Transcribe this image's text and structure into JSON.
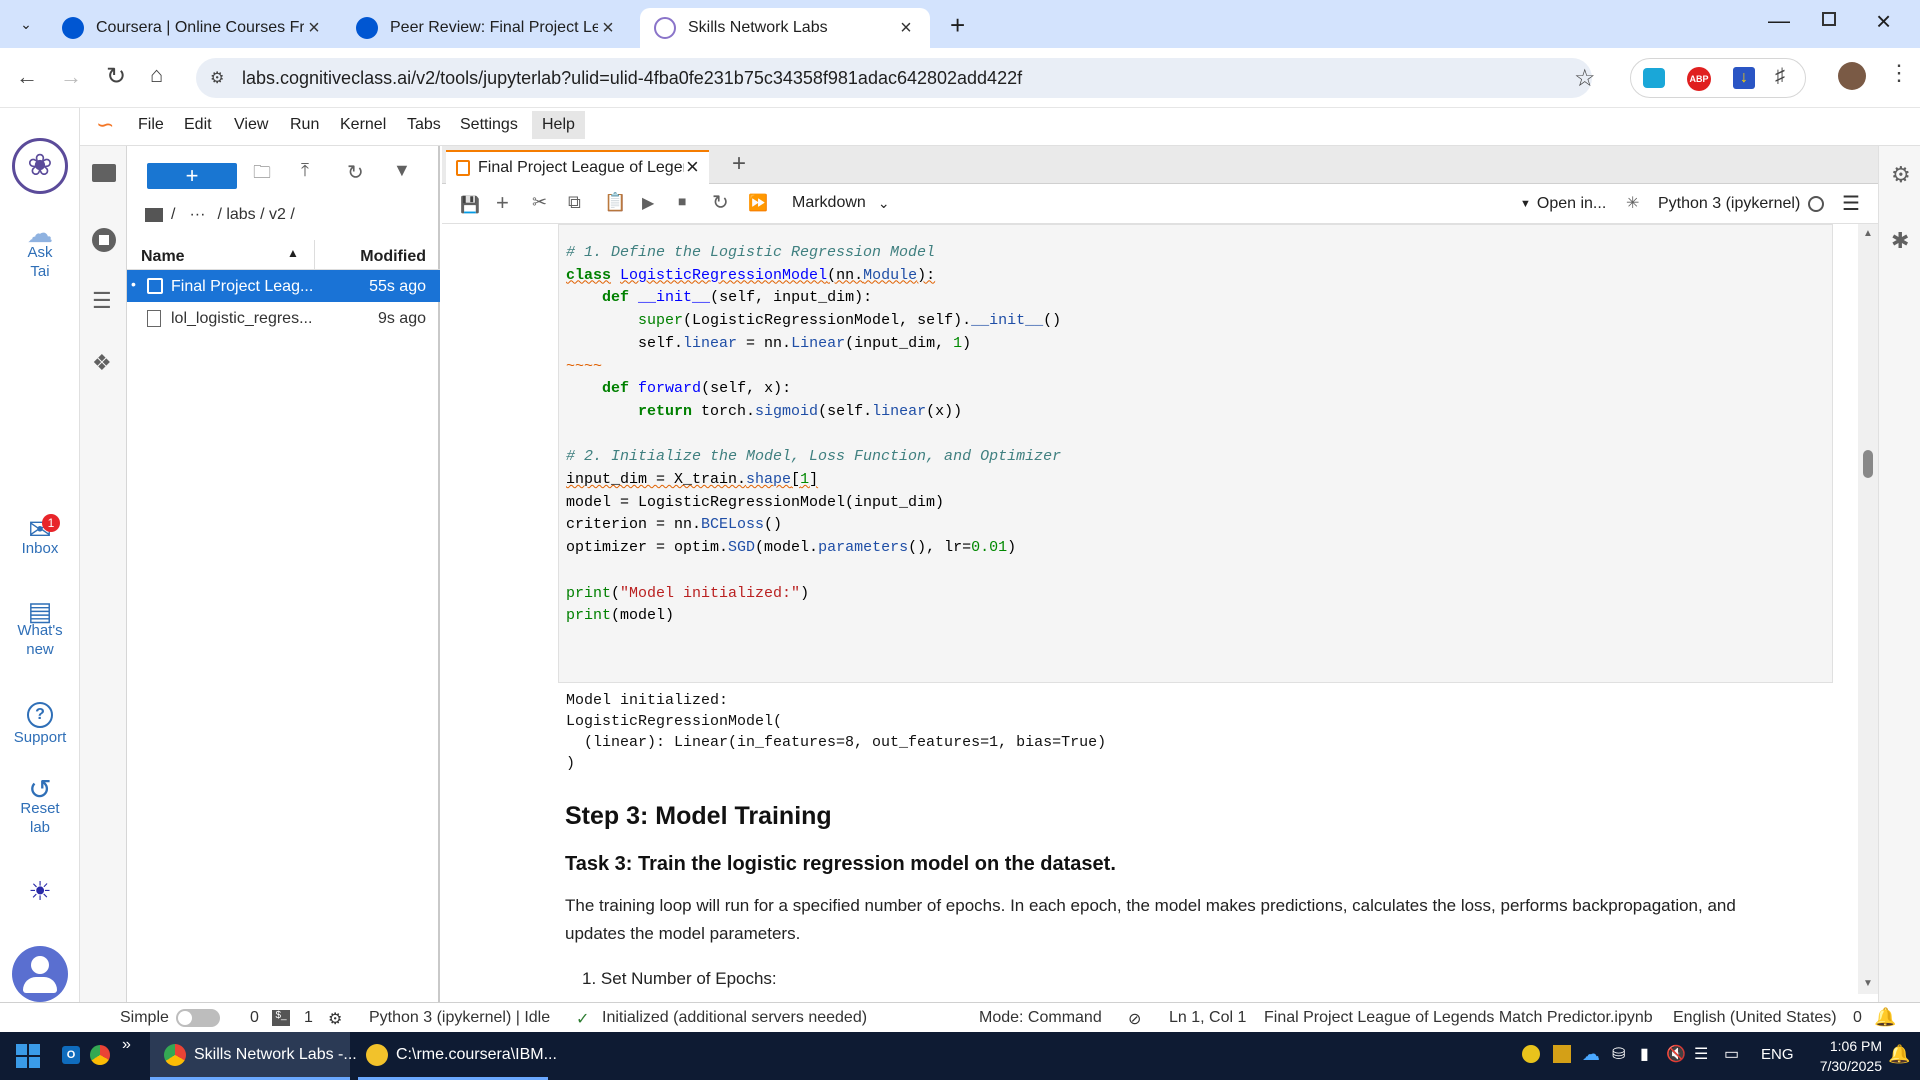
{
  "browser": {
    "tabs": [
      {
        "title": "Coursera | Online Courses From",
        "favicon_color": "#0056d2"
      },
      {
        "title": "Peer Review: Final Project Leagu",
        "favicon_color": "#0056d2"
      },
      {
        "title": "Skills Network Labs",
        "favicon_color": "#8a74c9",
        "active": true
      }
    ],
    "url": "labs.cognitiveclass.ai/v2/tools/jupyterlab?ulid=ulid-4fba0fe231b75c34358f981adac642802add422f"
  },
  "menu": [
    "File",
    "Edit",
    "View",
    "Run",
    "Kernel",
    "Tabs",
    "Settings",
    "Help"
  ],
  "rail": {
    "ask_tai": "Ask\nTai",
    "inbox": "Inbox",
    "inbox_count": "1",
    "whats_new": "What's\nnew",
    "support": "Support",
    "reset_lab": "Reset\nlab"
  },
  "filebrowser": {
    "path": [
      "/",
      "···",
      "/ labs / v2 /"
    ],
    "col_name": "Name",
    "col_modified": "Modified",
    "files": [
      {
        "name": "Final Project Leag...",
        "modified": "55s ago",
        "selected": true
      },
      {
        "name": "lol_logistic_regres...",
        "modified": "9s ago",
        "selected": false
      }
    ]
  },
  "notebook": {
    "tab_title": "Final Project League of Leger",
    "cell_type": "Markdown",
    "open_in": "Open in...",
    "kernel": "Python 3 (ipykernel)",
    "output": [
      "Model initialized:",
      "LogisticRegressionModel(",
      "  (linear): Linear(in_features=8, out_features=1, bias=True)",
      ")"
    ],
    "step_heading": "Step 3: Model Training",
    "task_heading": "Task 3: Train the logistic regression model on the dataset.",
    "paragraph_line1": "The training loop will run for a specified number of epochs. In each epoch, the model makes predictions, calculates the loss, performs backpropagation, and",
    "paragraph_line2": "updates the model parameters.",
    "list_item": "1. Set Number of Epochs:"
  },
  "status": {
    "mode_label": "Simple",
    "zero": "0",
    "one": "1",
    "kernel": "Python 3 (ipykernel) | Idle",
    "init": "Initialized (additional servers needed)",
    "mode": "Mode: Command",
    "position": "Ln 1, Col 1",
    "file": "Final Project League of Legends Match Predictor.ipynb",
    "lang": "English (United States)",
    "notif": "0"
  },
  "taskbar": {
    "app1": "Skills Network Labs -...",
    "app2": "C:\\rme.coursera\\IBM...",
    "lang": "ENG",
    "time": "1:06 PM",
    "date": "7/30/2025"
  }
}
